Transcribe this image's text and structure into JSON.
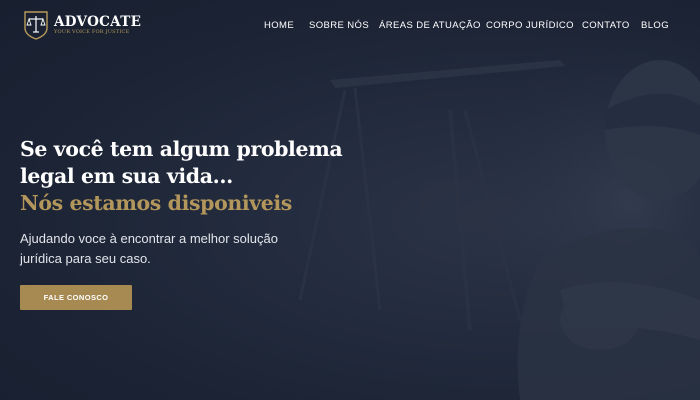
{
  "brand": {
    "name": "ADVOCATE",
    "tagline": "YOUR VOICE FOR JUSTICE",
    "gold_color": "#b3965b"
  },
  "nav": {
    "items": [
      {
        "label": "HOME"
      },
      {
        "label": "SOBRE NÓS"
      },
      {
        "label": "ÁREAS DE ATUAÇÃO"
      },
      {
        "label": "CORPO JURÍDICO"
      },
      {
        "label": "CONTATO"
      },
      {
        "label": "BLOG"
      }
    ]
  },
  "hero": {
    "headline_line1": "Se você tem algum problema",
    "headline_line2": "legal em sua vida...",
    "headline_highlight": "Nós estamos disponiveis",
    "subtitle_line1": "Ajudando voce à encontrar a melhor solução",
    "subtitle_line2": "jurídica para seu caso.",
    "cta_label": "FALE CONOSCO",
    "background": "dark navy overlay over Lady Justice statue with scales",
    "background_color": "#1c2537"
  },
  "icons": {
    "logo": "scales-of-justice-icon"
  }
}
